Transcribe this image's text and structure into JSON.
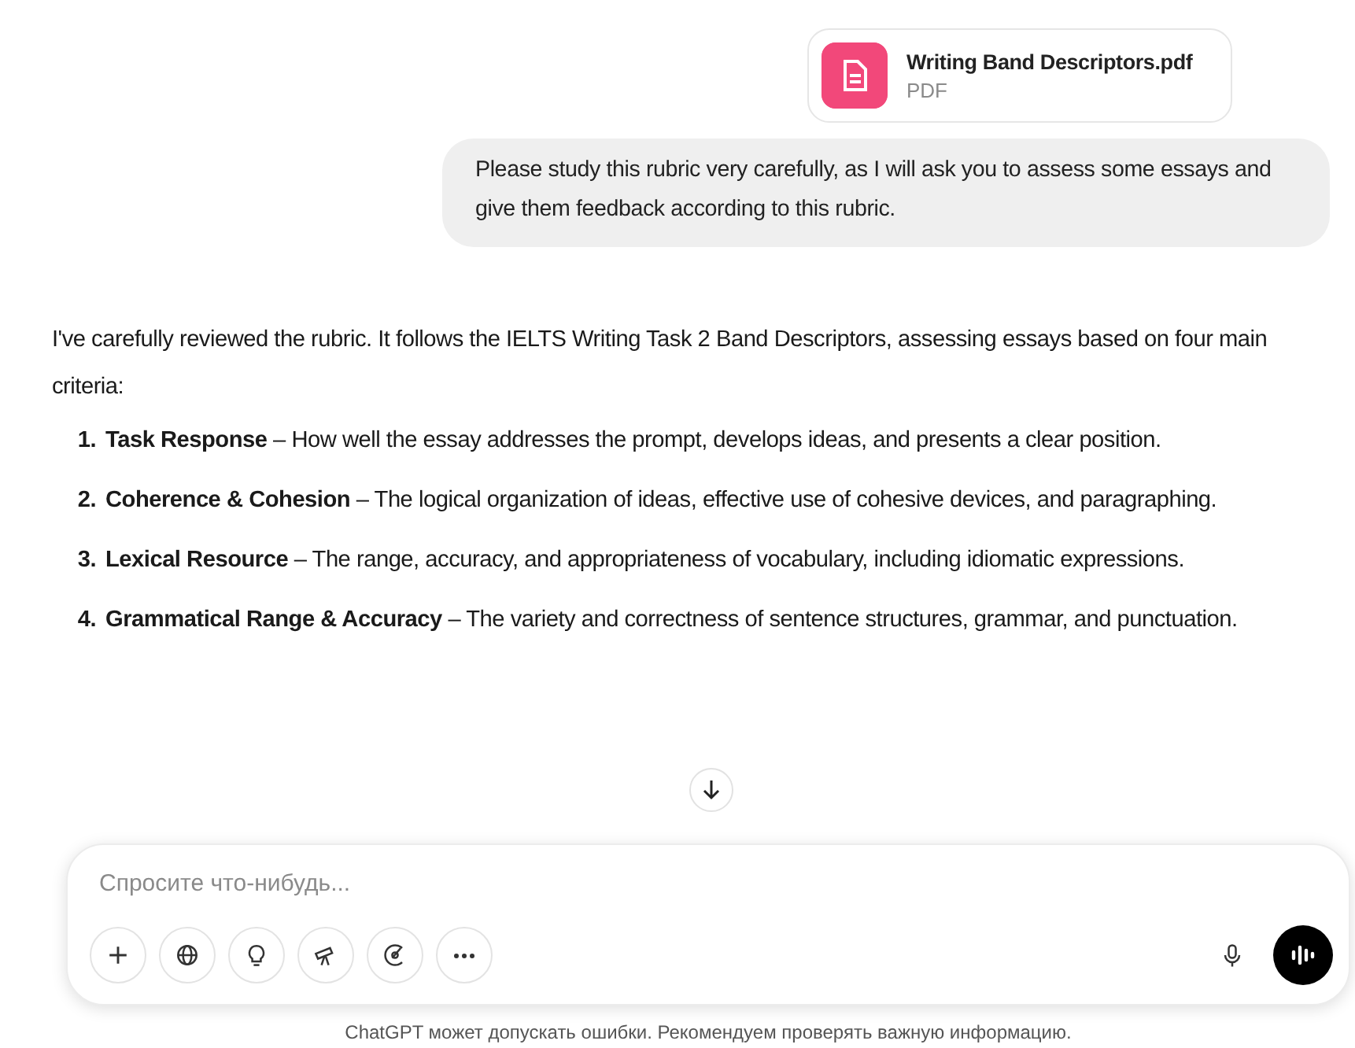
{
  "attachment": {
    "name": "Writing Band Descriptors.pdf",
    "type": "PDF"
  },
  "user_message": "Please study this rubric very carefully, as I will ask you to assess some essays and give them feedback according to this rubric.",
  "answer": {
    "intro": "I've carefully reviewed the rubric. It follows the IELTS Writing Task 2 Band Descriptors, assessing essays based on four main criteria:",
    "items": [
      {
        "number": "1.",
        "text": "**Task Response** – How well the essay addresses the prompt, develops ideas, and presents a clear position."
      },
      {
        "number": "2.",
        "text": "**Coherence & Cohesion** – The logical organization of ideas, effective use of cohesive devices, and paragraphing."
      },
      {
        "number": "3.",
        "text": "**Lexical Resource** – The range, accuracy, and appropriateness of vocabulary, including idiomatic expressions."
      },
      {
        "number": "4.",
        "text": "**Grammatical Range & Accuracy** – The variety and correctness of sentence structures, grammar, and punctuation."
      }
    ]
  },
  "composer": {
    "placeholder": "Спросите что-нибудь...",
    "tools": [
      {
        "kind": "plus"
      },
      {
        "kind": "globe"
      },
      {
        "kind": "bulb"
      },
      {
        "kind": "telescope"
      },
      {
        "kind": "brush"
      },
      {
        "kind": "more"
      }
    ]
  },
  "disclaimer": "ChatGPT может допускать ошибки. Рекомендуем проверять важную информацию."
}
